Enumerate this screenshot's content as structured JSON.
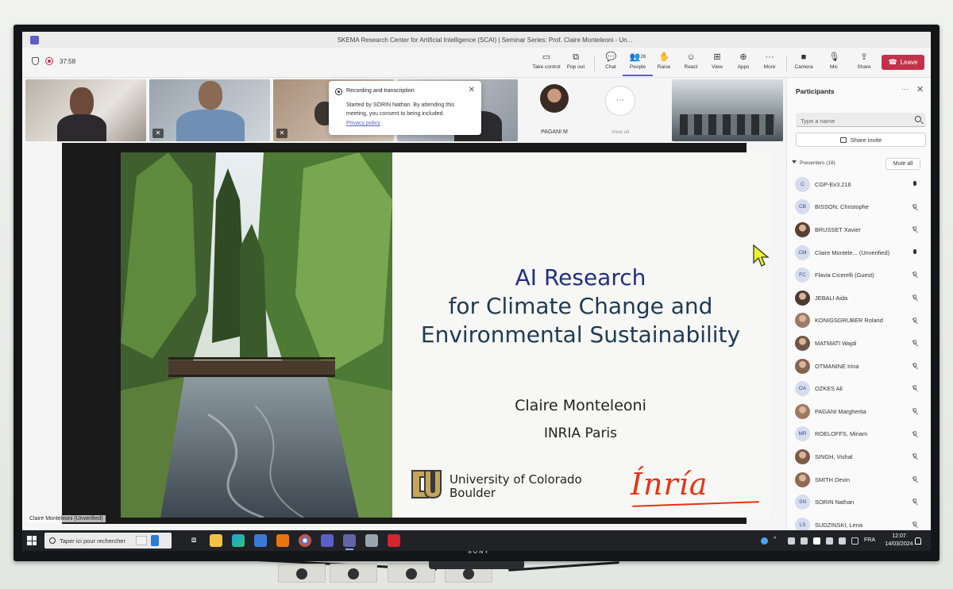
{
  "window": {
    "title": "SKEMA Research Center for Artificial Intelligence (SCAI) | Seminar Series: Prof. Claire Monteleoni - Un..."
  },
  "toolbar": {
    "timer": "37:58",
    "take_control": "Take control",
    "pop_out": "Pop out",
    "chat": "Chat",
    "people": "People",
    "people_count": "26",
    "raise": "Raise",
    "react": "React",
    "view": "View",
    "apps": "Apps",
    "more": "More",
    "camera": "Camera",
    "mic": "Mic",
    "share": "Share",
    "leave": "Leave"
  },
  "video_strip": {
    "tile5_name": "PAGANI M",
    "view_all": "View all"
  },
  "toast": {
    "title": "Recording and transcription",
    "body": "Started by SORIN Nathan. By attending this meeting, you consent to being included.",
    "link": "Privacy policy"
  },
  "slide": {
    "title_line1": "AI Research",
    "title_line2": "for Climate Change and",
    "title_line3": "Environmental Sustainability",
    "author": "Claire Monteleoni",
    "institution": "INRIA Paris",
    "cu_line1": "University of Colorado",
    "cu_line2": "Boulder",
    "inria_logo": "Inria"
  },
  "stage": {
    "speaker_label": "Claire Monteleoni (Unverified)"
  },
  "participants": {
    "title": "Participants",
    "search_placeholder": "Type a name",
    "share_invite": "Share invite",
    "presenters_label": "Presenters (18)",
    "mute_all": "Mute all",
    "list": [
      {
        "initials": "C",
        "name": "CGP-Ex3.216",
        "mic": "on",
        "avatar": "initials"
      },
      {
        "initials": "CB",
        "name": "BISSON, Christophe",
        "mic": "off",
        "avatar": "initials"
      },
      {
        "initials": "",
        "name": "BRUSSET Xavier",
        "mic": "off",
        "avatar": "photo"
      },
      {
        "initials": "CM",
        "name": "Claire Montele... (Unverified)",
        "mic": "on",
        "avatar": "initials"
      },
      {
        "initials": "FC",
        "name": "Flavia Cicerelli (Guest)",
        "mic": "off",
        "avatar": "initials"
      },
      {
        "initials": "",
        "name": "JEBALI Aida",
        "mic": "off",
        "avatar": "photo"
      },
      {
        "initials": "",
        "name": "KONIGSGRUBER Roland",
        "mic": "off",
        "avatar": "photo"
      },
      {
        "initials": "",
        "name": "MATMATI Wajdi",
        "mic": "off",
        "avatar": "photo"
      },
      {
        "initials": "",
        "name": "OTMANINE Irina",
        "mic": "off",
        "avatar": "photo"
      },
      {
        "initials": "OA",
        "name": "OZKES Ali",
        "mic": "off",
        "avatar": "initials"
      },
      {
        "initials": "",
        "name": "PAGANI Margherita",
        "mic": "off",
        "avatar": "photo"
      },
      {
        "initials": "MR",
        "name": "ROELOFFS, Miriam",
        "mic": "off",
        "avatar": "initials"
      },
      {
        "initials": "",
        "name": "SINGH, Vishal",
        "mic": "off",
        "avatar": "photo"
      },
      {
        "initials": "",
        "name": "SMITH Devin",
        "mic": "off",
        "avatar": "photo"
      },
      {
        "initials": "SN",
        "name": "SORIN Nathan",
        "mic": "off",
        "avatar": "initials"
      },
      {
        "initials": "LS",
        "name": "SUDZINSKI, Lena",
        "mic": "off",
        "avatar": "initials"
      }
    ]
  },
  "taskbar": {
    "search_text": "Taper ici pour rechercher",
    "lang": "FRA",
    "time": "12:07",
    "date": "14/03/2024"
  },
  "device": {
    "brand": "SONY"
  },
  "colors": {
    "teams_purple": "#5b5fc7",
    "leave_red": "#c4314b",
    "inria_red": "#e63312",
    "slide_title_blue": "#1f2f86",
    "slide_title_teal": "#1f3a52"
  }
}
